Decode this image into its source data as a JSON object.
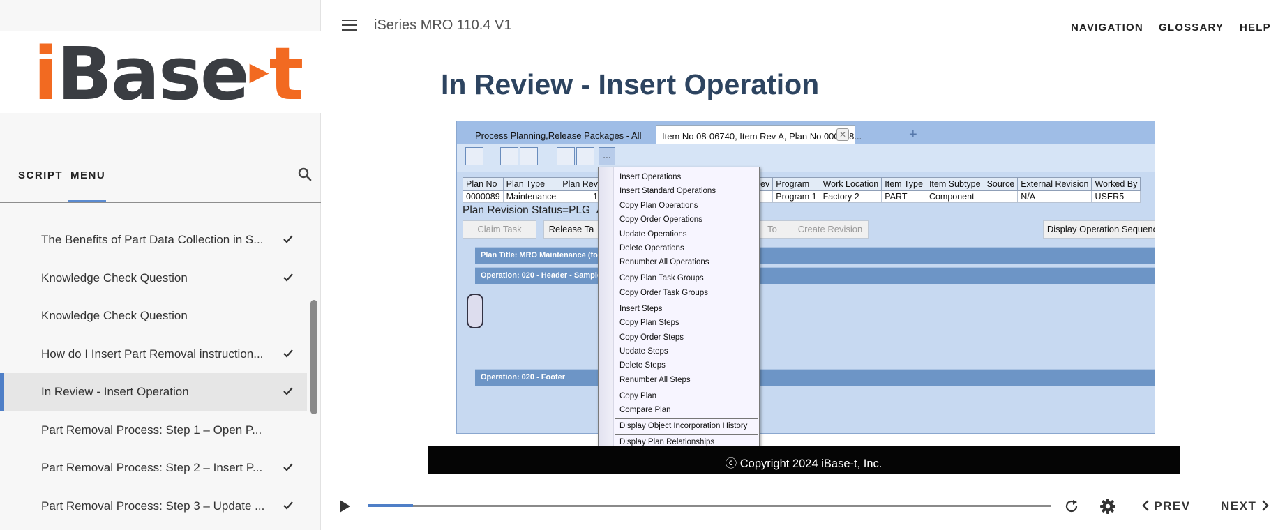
{
  "logo": {
    "i": "i",
    "base": "Base",
    "t": "t"
  },
  "sidebar": {
    "tab_script": "SCRIPT",
    "tab_menu": "MENU",
    "items": [
      {
        "label": "The Benefits of Part Data Collection in S...",
        "checked": true
      },
      {
        "label": "Knowledge Check Question",
        "checked": true
      },
      {
        "label": "Knowledge Check Question",
        "checked": false
      },
      {
        "label": "How do I Insert Part Removal instruction...",
        "checked": true
      },
      {
        "label": "In Review - Insert Operation",
        "checked": true,
        "active": true
      },
      {
        "label": "Part Removal Process: Step 1 – Open P...",
        "checked": false
      },
      {
        "label": "Part Removal Process: Step 2 – Insert P...",
        "checked": true
      },
      {
        "label": "Part Removal Process: Step 3 – Update ...",
        "checked": true
      }
    ]
  },
  "header": {
    "course_title": "iSeries MRO 110.4 V1",
    "nav": "NAVIGATION",
    "glossary": "GLOSSARY",
    "help": "HELP"
  },
  "main": {
    "title": "In Review - Insert Operation",
    "copyright": "ⓒ Copyright 2024 iBase-t, Inc."
  },
  "app": {
    "tab1": "Process Planning,Release Packages - All",
    "tab2": "Item No  08-06740, Item Rev  A, Plan No  000008...",
    "tab_close": "✕",
    "tab_add": "+",
    "toolbar_more": "...",
    "grid": {
      "left_headers": [
        "Plan No",
        "Plan Type",
        "Plan Rev"
      ],
      "left_row": [
        "0000089",
        "Maintenance",
        "1"
      ],
      "right_headers": [
        "Rev",
        "Program",
        "Work Location",
        "Item Type",
        "Item Subtype",
        "Source",
        "External Revision",
        "Worked By"
      ],
      "right_row": [
        "",
        "Program 1",
        "Factory 2",
        "PART",
        "Component",
        "",
        "N/A",
        "USER5"
      ]
    },
    "status": "Plan Revision Status=PLG_A",
    "buttons": {
      "claim_task": "Claim Task",
      "release_task": "Release Ta",
      "to": "To",
      "create_revision": "Create Revision",
      "display_sequence": "Display Operation Sequenc"
    },
    "bands": {
      "plan_title": "Plan Title: MRO Maintenance (for eLea",
      "operation_header": "Operation: 020 - Header  - Sample Title",
      "operation_footer": "Operation: 020 - Footer"
    },
    "context_menu": [
      "Insert Operations",
      "Insert Standard Operations",
      "Copy Plan Operations",
      "Copy Order Operations",
      "Update Operations",
      "Delete Operations",
      "Renumber All Operations",
      "Copy Plan Task Groups",
      "Copy Order Task Groups",
      "Insert Steps",
      "Copy Plan Steps",
      "Copy Order Steps",
      "Update Steps",
      "Delete Steps",
      "Renumber All Steps",
      "Copy Plan",
      "Compare Plan",
      "Display Object Incorporation History",
      "Display Plan Relationships"
    ]
  },
  "player": {
    "prev": "PREV",
    "next": "NEXT",
    "progress": 0.066
  },
  "colors": {
    "accent": "#4f7fc7",
    "logo_orange": "#f26a21",
    "logo_dark": "#3a3d42",
    "title": "#2d4460"
  }
}
